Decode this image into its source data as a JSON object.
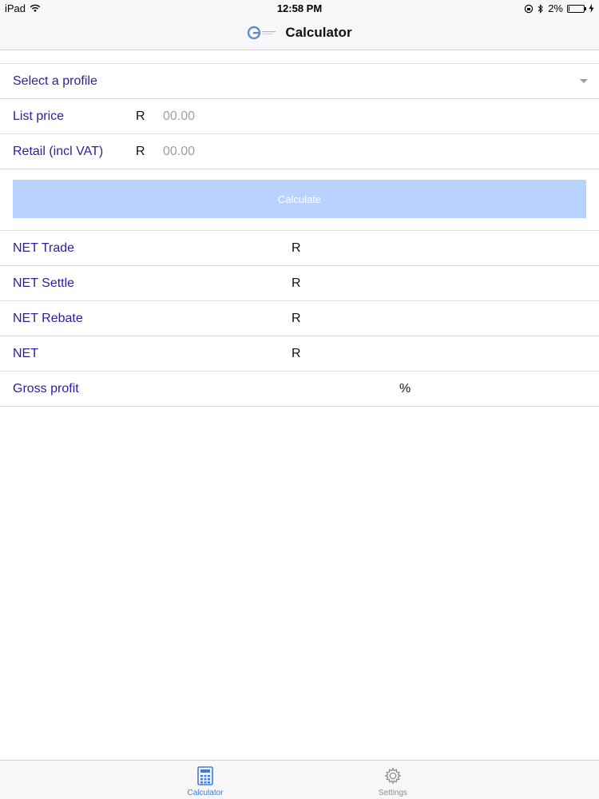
{
  "status_bar": {
    "device": "iPad",
    "time": "12:58 PM",
    "battery": "2%"
  },
  "nav": {
    "title": "Calculator"
  },
  "form": {
    "profile_placeholder": "Select a profile",
    "list_price_label": "List price",
    "list_price_currency": "R",
    "list_price_placeholder": "00.00",
    "retail_label": "Retail (incl VAT)",
    "retail_currency": "R",
    "retail_placeholder": "00.00",
    "calculate_label": "Calculate"
  },
  "results": [
    {
      "label": "NET Trade",
      "unit": "R"
    },
    {
      "label": "NET Settle",
      "unit": "R"
    },
    {
      "label": "NET Rebate",
      "unit": "R"
    },
    {
      "label": "NET",
      "unit": "R"
    },
    {
      "label": "Gross profit",
      "unit": "%"
    }
  ],
  "tabs": [
    {
      "label": "Calculator",
      "icon": "calculator-icon",
      "active": true
    },
    {
      "label": "Settings",
      "icon": "gear-icon",
      "active": false
    }
  ],
  "colors": {
    "label": "#2a1f9e",
    "button": "#b8d3ff",
    "tab_active": "#3b7de0"
  }
}
